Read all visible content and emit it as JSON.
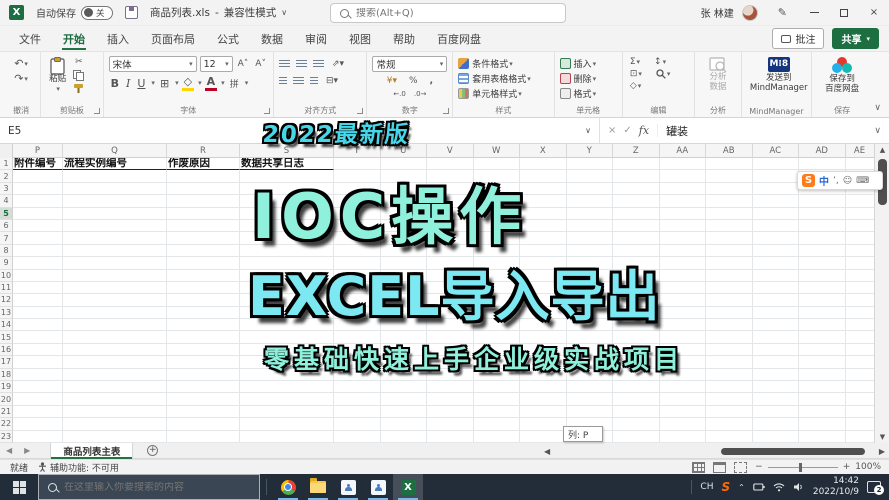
{
  "colors": {
    "accent_green": "#217346",
    "overlay_mint": "#8ff0dc",
    "overlay_cyan": "#7ce9f2",
    "badge_cyan": "#45d7e8",
    "taskbar_bg": "#232d3a"
  },
  "titlebar": {
    "autosave_label": "自动保存",
    "autosave_state": "关",
    "doc_title": "商品列表.xls",
    "separator": "-",
    "doc_mode": "兼容性模式",
    "search_placeholder": "搜索(Alt+Q)",
    "user_name": "张 林建"
  },
  "tabs": [
    {
      "label": "文件",
      "active": false
    },
    {
      "label": "开始",
      "active": true
    },
    {
      "label": "插入",
      "active": false
    },
    {
      "label": "页面布局",
      "active": false
    },
    {
      "label": "公式",
      "active": false
    },
    {
      "label": "数据",
      "active": false
    },
    {
      "label": "审阅",
      "active": false
    },
    {
      "label": "视图",
      "active": false
    },
    {
      "label": "帮助",
      "active": false
    },
    {
      "label": "百度网盘",
      "active": false
    }
  ],
  "tab_actions": {
    "comments": "批注",
    "share": "共享"
  },
  "ribbon": {
    "undo_label": "撤消",
    "clipboard": {
      "paste": "粘贴",
      "label": "剪贴板"
    },
    "font": {
      "name": "宋体",
      "size": "12",
      "label": "字体"
    },
    "align_label": "对齐方式",
    "number": {
      "format": "常规",
      "label": "数字"
    },
    "styles": {
      "item1": "条件格式",
      "item2": "套用表格格式",
      "item3": "单元格样式",
      "label": "样式"
    },
    "cells": {
      "item1": "插入",
      "item2": "删除",
      "item3": "格式",
      "label": "单元格"
    },
    "edit_label": "编辑",
    "analysis": {
      "line1": "分析",
      "line2": "数据",
      "label": "分析"
    },
    "mindmanager": {
      "line1": "发送到",
      "line2": "MindManager",
      "label": "MindManager"
    },
    "save": {
      "line1": "保存到",
      "line2": "百度网盘",
      "label": "保存"
    }
  },
  "formula_bar": {
    "name_box": "E5",
    "fx": "fx",
    "value": "罐装"
  },
  "overlay": {
    "badge": "2022最新版",
    "line1": "IOC操作",
    "line2": "EXCEL导入导出",
    "line3": "零基础快速上手企业级实战项目"
  },
  "grid": {
    "columns": [
      "P",
      "Q",
      "R",
      "S",
      "T",
      "U",
      "V",
      "W",
      "X",
      "Y",
      "Z",
      "AA",
      "AB",
      "AC",
      "AD",
      "AE"
    ],
    "row_count": 23,
    "selected_row": 5,
    "header_row": [
      {
        "col": "P",
        "text": "附件编号"
      },
      {
        "col": "Q",
        "text": "流程实例编号"
      },
      {
        "col": "R",
        "text": "作废原因"
      },
      {
        "col": "S",
        "text": "数据共享日志"
      }
    ],
    "column_tooltip": "列: P"
  },
  "ime_bar": {
    "logo": "S",
    "lang": "中"
  },
  "sheet_bar": {
    "active_tab": "商品列表主表"
  },
  "status_bar": {
    "ready": "就绪",
    "accessibility": "辅助功能: 不可用",
    "zoom_level": "100%"
  },
  "taskbar": {
    "search_placeholder": "在这里输入你要搜索的内容",
    "tray": {
      "lang": "CH",
      "ime_logo": "S",
      "time": "14:42",
      "date": "2022/10/9",
      "badge": "2"
    }
  }
}
